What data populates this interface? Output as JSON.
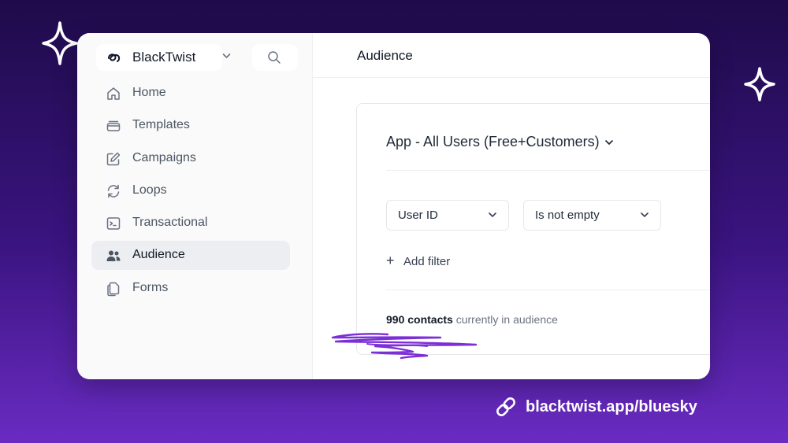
{
  "app": {
    "workspace_name": "BlackTwist"
  },
  "sidebar": {
    "items": [
      {
        "label": "Home",
        "icon": "home-icon"
      },
      {
        "label": "Templates",
        "icon": "templates-icon"
      },
      {
        "label": "Campaigns",
        "icon": "edit-icon"
      },
      {
        "label": "Loops",
        "icon": "loop-icon"
      },
      {
        "label": "Transactional",
        "icon": "terminal-icon"
      },
      {
        "label": "Audience",
        "icon": "users-icon",
        "active": true
      },
      {
        "label": "Forms",
        "icon": "forms-icon"
      }
    ]
  },
  "header": {
    "title": "Audience"
  },
  "audience": {
    "selected": "App - All Users (Free+Customers)",
    "filter": {
      "field": "User ID",
      "operator": "Is not empty"
    },
    "add_filter_label": "Add filter",
    "count_strong": "990 contacts",
    "count_rest": " currently in audience"
  },
  "footer": {
    "link_text": "blacktwist.app/bluesky"
  },
  "colors": {
    "accent_purple": "#7c2fd6",
    "active_nav_bg": "#eceef1"
  }
}
